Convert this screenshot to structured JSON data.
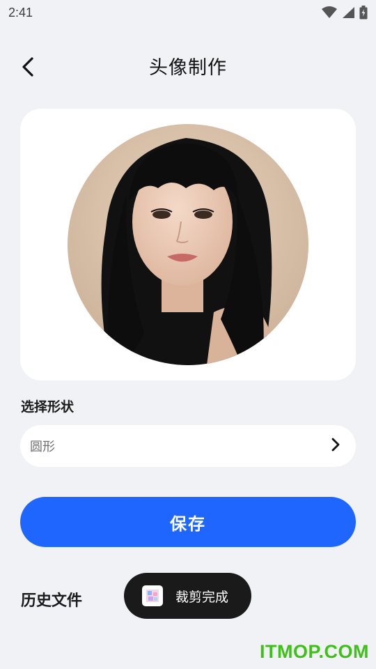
{
  "status": {
    "time": "2:41",
    "icons": [
      "wifi-icon",
      "signal-icon",
      "battery-charging-icon"
    ]
  },
  "header": {
    "back_icon": "chevron-left-icon",
    "title": "头像制作"
  },
  "preview": {
    "shape": "circle",
    "image": "portrait of a woman with long black hair and bangs"
  },
  "shape_section": {
    "label": "选择形状",
    "value": "圆形",
    "chevron_icon": "chevron-right-icon"
  },
  "actions": {
    "save_label": "保存"
  },
  "history": {
    "title": "历史文件"
  },
  "toast": {
    "icon": "image-thumbnail-icon",
    "text": "裁剪完成"
  },
  "watermark": {
    "text": "ITMOP.COM"
  },
  "colors": {
    "background": "#f1f2f6",
    "card": "#ffffff",
    "primary": "#1f66ff",
    "toast_bg": "#1a1a1a",
    "watermark": "#3fbf1a"
  }
}
